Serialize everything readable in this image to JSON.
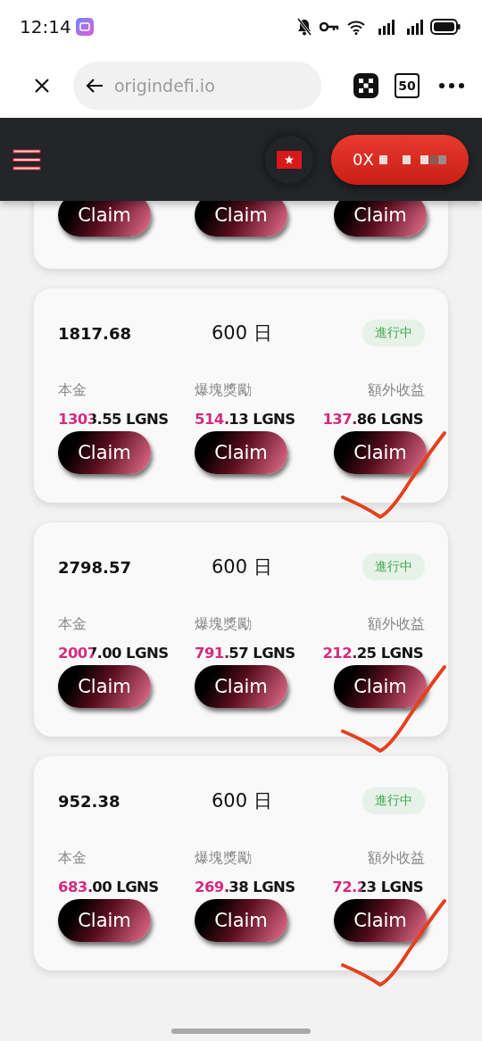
{
  "status_bar": {
    "time": "12:14"
  },
  "browser": {
    "url": "origindefi.io",
    "tab_count": "50"
  },
  "header": {
    "wallet": "0X"
  },
  "cards": [
    {
      "kind": "partial",
      "marked": false,
      "columns": [
        {
          "button": "Claim"
        },
        {
          "button": "Claim"
        },
        {
          "button": "Claim"
        }
      ]
    },
    {
      "kind": "full",
      "marked": true,
      "total": "1817.68",
      "duration": "600 日",
      "status": "進行中",
      "columns": [
        {
          "label": "本金",
          "amount": "1303.55 LGNS",
          "button": "Claim"
        },
        {
          "label": "爆塊獎勵",
          "amount": "514.13 LGNS",
          "button": "Claim"
        },
        {
          "label": "額外收益",
          "amount": "137.86 LGNS",
          "button": "Claim"
        }
      ]
    },
    {
      "kind": "full",
      "marked": true,
      "total": "2798.57",
      "duration": "600 日",
      "status": "進行中",
      "columns": [
        {
          "label": "本金",
          "amount": "2007.00 LGNS",
          "button": "Claim"
        },
        {
          "label": "爆塊獎勵",
          "amount": "791.57 LGNS",
          "button": "Claim"
        },
        {
          "label": "額外收益",
          "amount": "212.25 LGNS",
          "button": "Claim"
        }
      ]
    },
    {
      "kind": "full",
      "marked": true,
      "total": "952.38",
      "duration": "600 日",
      "status": "進行中",
      "columns": [
        {
          "label": "本金",
          "amount": "683.00 LGNS",
          "button": "Claim"
        },
        {
          "label": "爆塊獎勵",
          "amount": "269.38 LGNS",
          "button": "Claim"
        },
        {
          "label": "額外收益",
          "amount": "72.23 LGNS",
          "button": "Claim"
        }
      ]
    }
  ]
}
